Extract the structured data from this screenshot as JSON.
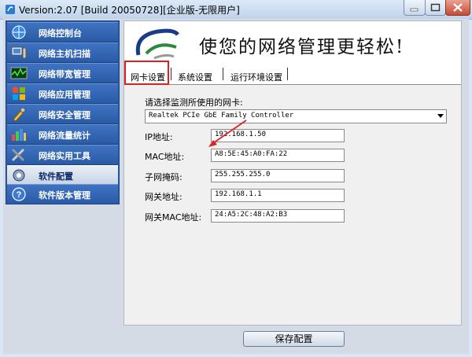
{
  "window": {
    "title": "Version:2.07 [Build 20050728][企业版-无限用户]"
  },
  "colors": {
    "sidebar_bg": "#2a5aa4",
    "highlight": "#e02020",
    "arrow": "#e02020"
  },
  "sidebar": {
    "items": [
      {
        "label": "网络控制台",
        "icon": "network-console-icon",
        "active": false
      },
      {
        "label": "网络主机扫描",
        "icon": "host-scan-icon",
        "active": false
      },
      {
        "label": "网络带宽管理",
        "icon": "bandwidth-icon",
        "active": false
      },
      {
        "label": "网络应用管理",
        "icon": "app-management-icon",
        "active": false
      },
      {
        "label": "网络安全管理",
        "icon": "security-icon",
        "active": false
      },
      {
        "label": "网络流量统计",
        "icon": "traffic-stats-icon",
        "active": false
      },
      {
        "label": "网络实用工具",
        "icon": "tools-icon",
        "active": false
      },
      {
        "label": "软件配置",
        "icon": "settings-icon",
        "active": true
      },
      {
        "label": "软件版本管理",
        "icon": "help-icon",
        "active": false
      }
    ]
  },
  "banner": {
    "slogan": "使您的网络管理更轻松!"
  },
  "tabs": [
    {
      "label": "网卡设置",
      "active": true
    },
    {
      "label": "系统设置",
      "active": false
    },
    {
      "label": "运行环境设置",
      "active": false
    }
  ],
  "nic": {
    "prompt": "请选择监测所使用的网卡:",
    "selected": "Realtek PCIe GbE Family Controller",
    "fields": [
      {
        "label": "IP地址:",
        "value": "192.168.1.50"
      },
      {
        "label": "MAC地址:",
        "value": "A8:5E:45:A0:FA:22"
      },
      {
        "label": "子网掩码:",
        "value": "255.255.255.0"
      },
      {
        "label": "网关地址:",
        "value": "192.168.1.1"
      },
      {
        "label": "网关MAC地址:",
        "value": "24:A5:2C:48:A2:B3"
      }
    ]
  },
  "footer": {
    "save_label": "保存配置"
  }
}
